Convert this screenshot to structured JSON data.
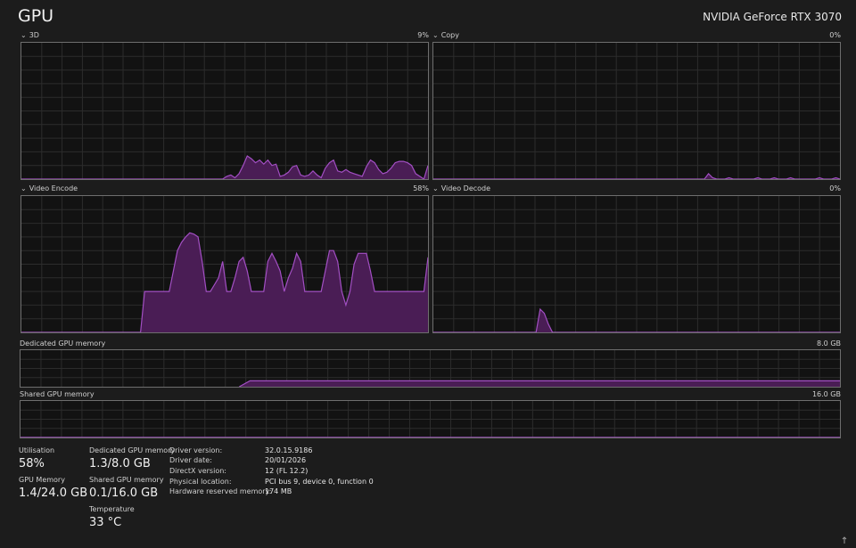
{
  "header": {
    "title": "GPU",
    "gpu_name": "NVIDIA GeForce RTX 3070"
  },
  "engines": [
    {
      "name": "3D",
      "percent": "9%",
      "utilization": 9,
      "series": [
        0,
        0,
        0,
        0,
        0,
        0,
        0,
        0,
        0,
        0,
        0,
        0,
        0,
        0,
        0,
        0,
        0,
        0,
        0,
        0,
        0,
        0,
        0,
        0,
        0,
        0,
        0,
        0,
        0,
        0,
        0,
        0,
        0,
        0,
        0,
        0,
        0,
        0,
        0,
        0,
        0,
        0,
        0,
        0,
        0,
        0,
        0,
        0,
        0,
        0,
        2,
        3,
        1,
        4,
        10,
        17,
        15,
        12,
        14,
        11,
        14,
        10,
        11,
        2,
        3,
        5,
        9,
        10,
        3,
        2,
        3,
        6,
        3,
        1,
        8,
        12,
        14,
        6,
        5,
        7,
        5,
        4,
        3,
        2,
        9,
        14,
        12,
        7,
        4,
        5,
        8,
        12,
        13,
        13,
        12,
        10,
        4,
        2,
        0,
        10
      ]
    },
    {
      "name": "Copy",
      "percent": "0%",
      "utilization": 0,
      "series": [
        0,
        0,
        0,
        0,
        0,
        0,
        0,
        0,
        0,
        0,
        0,
        0,
        0,
        0,
        0,
        0,
        0,
        0,
        0,
        0,
        0,
        0,
        0,
        0,
        0,
        0,
        0,
        0,
        0,
        0,
        0,
        0,
        0,
        0,
        0,
        0,
        0,
        0,
        0,
        0,
        0,
        0,
        0,
        0,
        0,
        0,
        0,
        0,
        0,
        0,
        0,
        0,
        0,
        0,
        0,
        0,
        0,
        0,
        0,
        0,
        0,
        0,
        0,
        0,
        0,
        0,
        0,
        4,
        1,
        0,
        0,
        0,
        1,
        0,
        0,
        0,
        0,
        0,
        0,
        1,
        0,
        0,
        0,
        1,
        0,
        0,
        0,
        1,
        0,
        0,
        0,
        0,
        0,
        0,
        1,
        0,
        0,
        0,
        1,
        0
      ]
    },
    {
      "name": "Video Encode",
      "percent": "58%",
      "utilization": 58,
      "series": [
        0,
        0,
        0,
        0,
        0,
        0,
        0,
        0,
        0,
        0,
        0,
        0,
        0,
        0,
        0,
        0,
        0,
        0,
        0,
        0,
        0,
        0,
        0,
        0,
        0,
        0,
        0,
        0,
        0,
        0,
        30,
        30,
        30,
        30,
        30,
        30,
        30,
        45,
        60,
        66,
        70,
        73,
        72,
        70,
        52,
        30,
        30,
        35,
        40,
        52,
        30,
        30,
        40,
        52,
        55,
        45,
        30,
        30,
        30,
        30,
        52,
        58,
        52,
        45,
        30,
        40,
        47,
        58,
        52,
        30,
        30,
        30,
        30,
        30,
        45,
        60,
        60,
        52,
        30,
        20,
        30,
        50,
        58,
        58,
        58,
        45,
        30,
        30,
        30,
        30,
        30,
        30,
        30,
        30,
        30,
        30,
        30,
        30,
        30,
        55
      ]
    },
    {
      "name": "Video Decode",
      "percent": "0%",
      "utilization": 0,
      "series": [
        0,
        0,
        0,
        0,
        0,
        0,
        0,
        0,
        0,
        0,
        0,
        0,
        0,
        0,
        0,
        0,
        0,
        0,
        0,
        0,
        0,
        0,
        0,
        0,
        0,
        0,
        17,
        14,
        6,
        0,
        0,
        0,
        0,
        0,
        0,
        0,
        0,
        0,
        0,
        0,
        0,
        0,
        0,
        0,
        0,
        0,
        0,
        0,
        0,
        0,
        0,
        0,
        0,
        0,
        0,
        0,
        0,
        0,
        0,
        0,
        0,
        0,
        0,
        0,
        0,
        0,
        0,
        0,
        0,
        0,
        0,
        0,
        0,
        0,
        0,
        0,
        0,
        0,
        0,
        0,
        0,
        0,
        0,
        0,
        0,
        0,
        0,
        0,
        0,
        0,
        0,
        0,
        0,
        0,
        0,
        0,
        0,
        0,
        0,
        0
      ]
    }
  ],
  "memory_graphs": [
    {
      "name": "Dedicated GPU memory",
      "max": "8.0 GB",
      "max_gb": 8.0,
      "used_gb": 1.3,
      "start_fraction": 0.28
    },
    {
      "name": "Shared GPU memory",
      "max": "16.0 GB",
      "max_gb": 16.0,
      "used_gb": 0.1,
      "start_fraction": 0.0
    }
  ],
  "stats": {
    "utilisation_label": "Utilisation",
    "utilisation_value": "58%",
    "gpu_memory_label": "GPU Memory",
    "gpu_memory_value": "1.4/24.0 GB",
    "dedicated_label": "Dedicated GPU memory",
    "dedicated_value": "1.3/8.0 GB",
    "shared_label": "Shared GPU memory",
    "shared_value": "0.1/16.0 GB",
    "temperature_label": "Temperature",
    "temperature_value": "33 °C"
  },
  "info": [
    {
      "key": "Driver version:",
      "value": "32.0.15.9186"
    },
    {
      "key": "Driver date:",
      "value": "20/01/2026"
    },
    {
      "key": "DirectX version:",
      "value": "12 (FL 12.2)"
    },
    {
      "key": "Physical location:",
      "value": "PCI bus 9, device 0, function 0"
    },
    {
      "key": "Hardware reserved memory:",
      "value": "174 MB"
    }
  ],
  "colors": {
    "accent": "#a24fc3",
    "fill": "#4a1d55",
    "grid": "#2c2c2c",
    "border": "#6e6e6e"
  },
  "chevron": "chevron-down-icon"
}
